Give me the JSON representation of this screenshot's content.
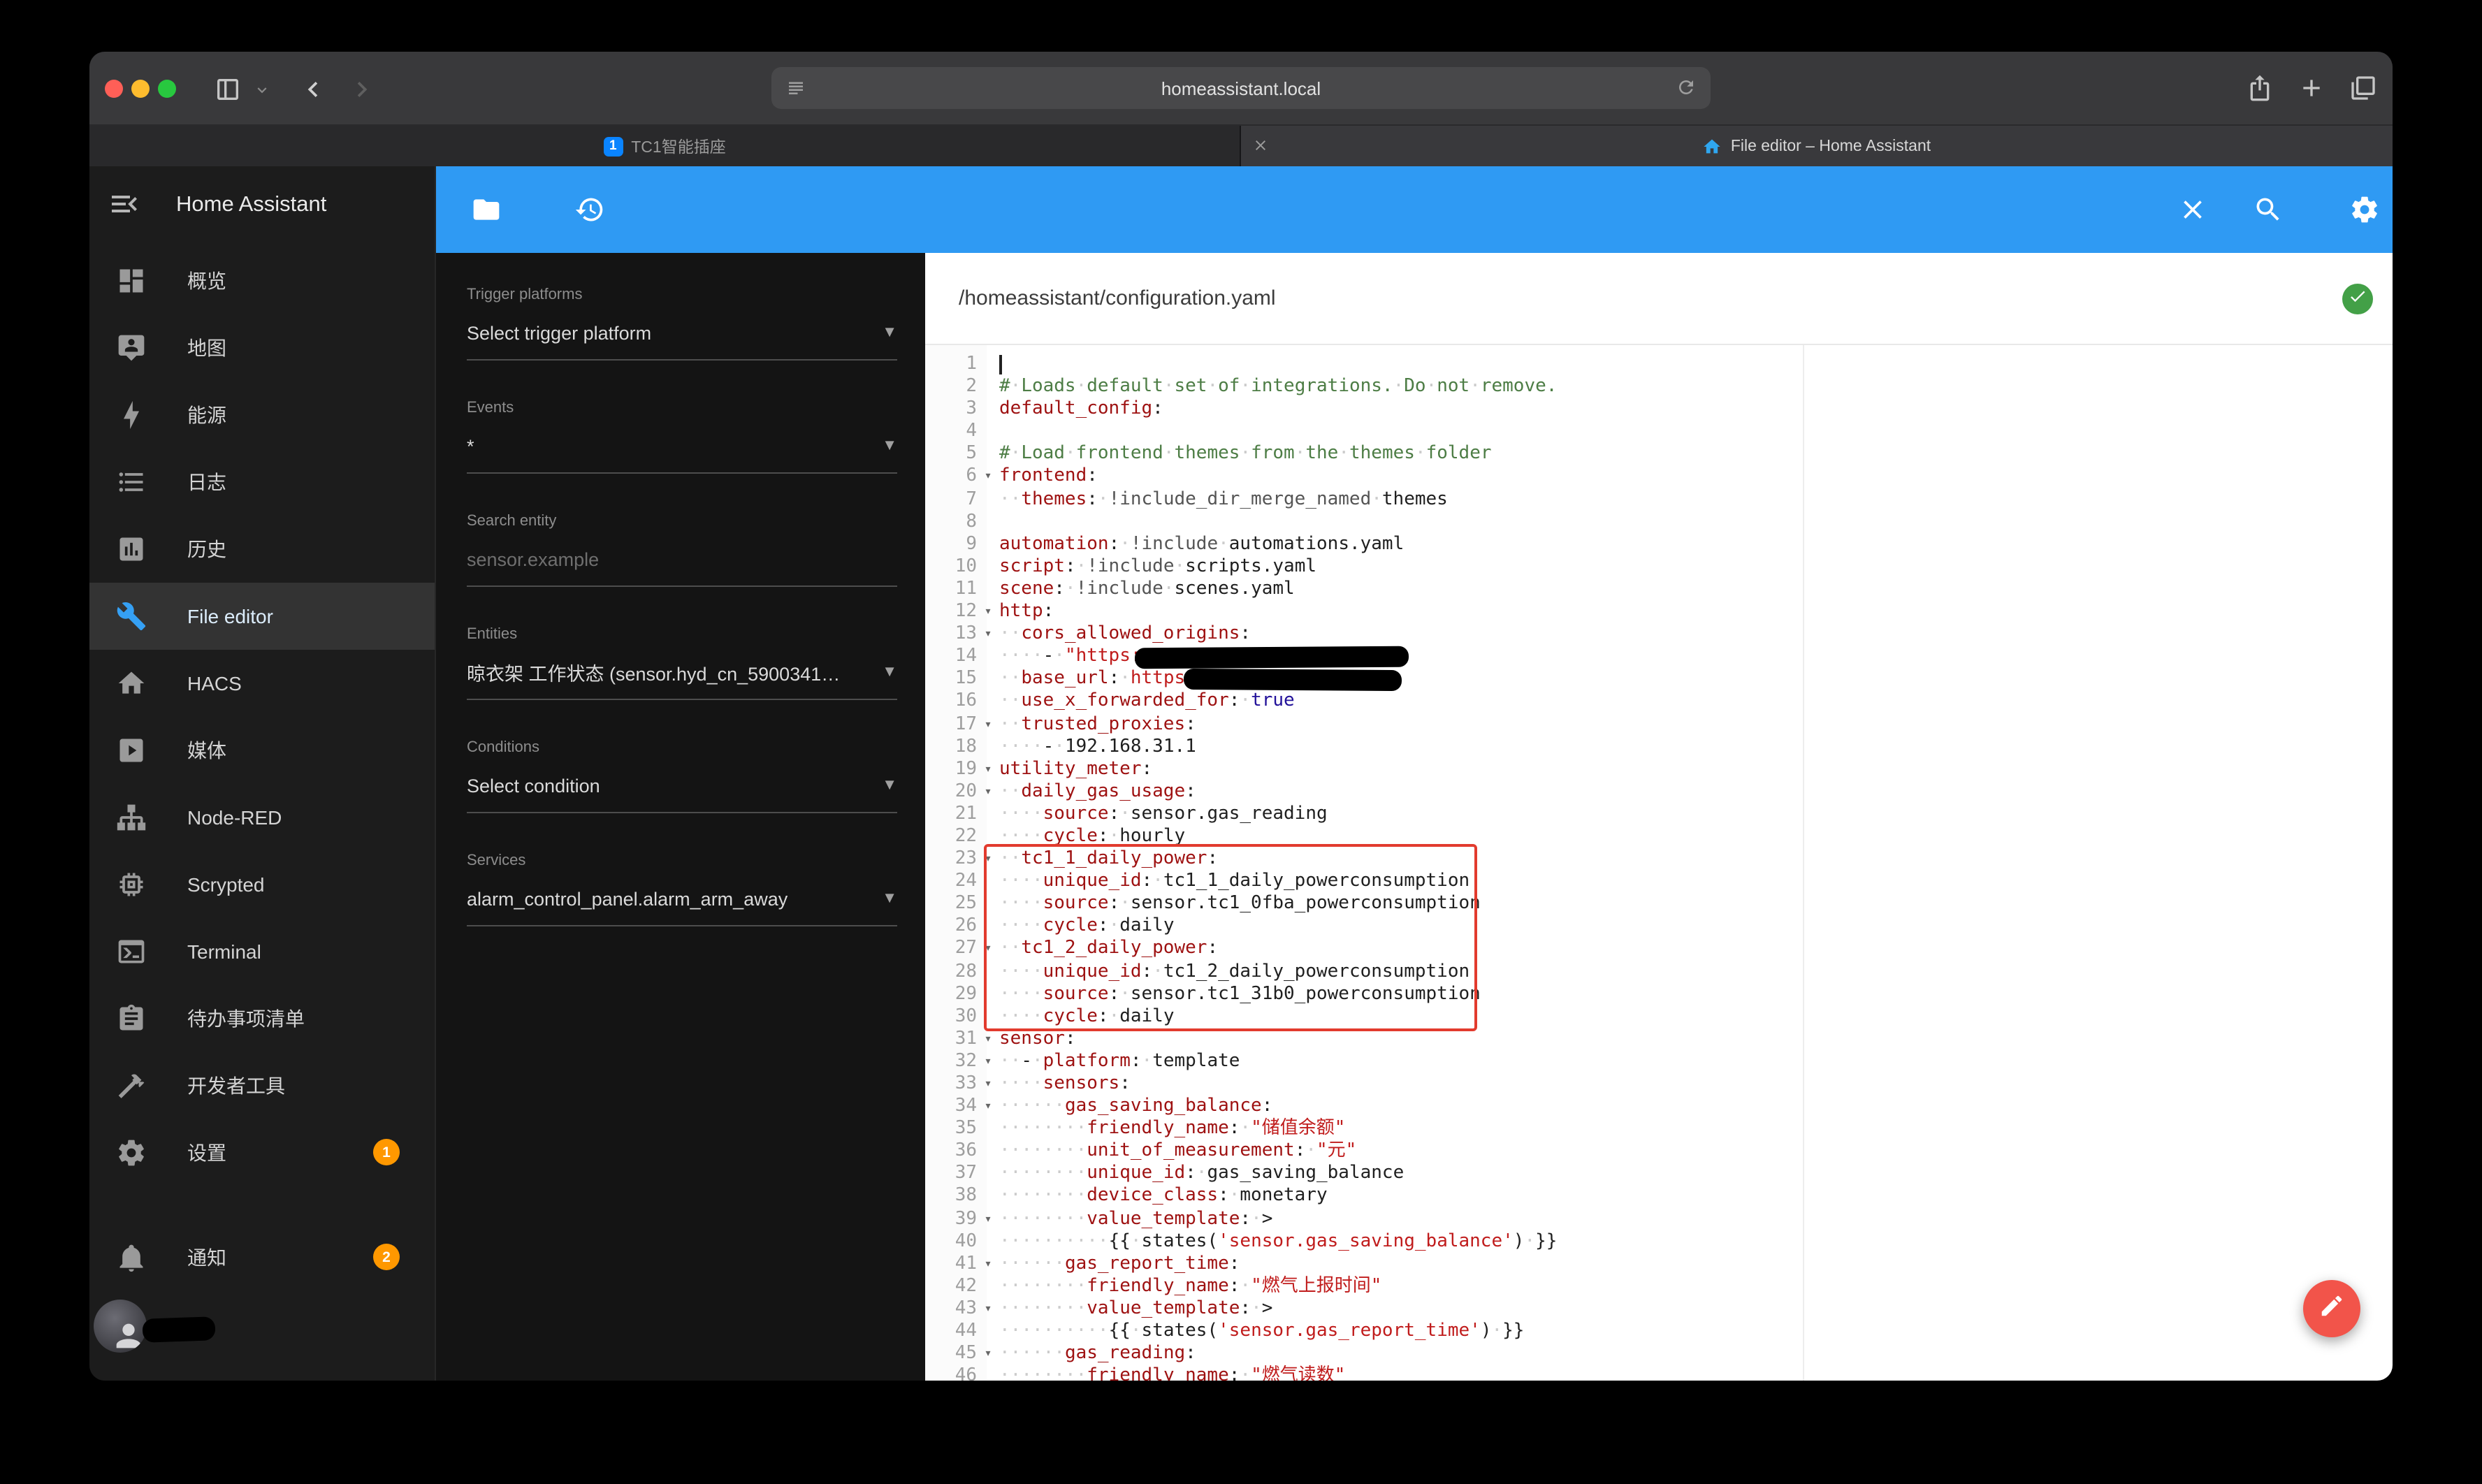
{
  "colors": {
    "toolbar-blue": "#2f9af3",
    "accent-orange": "#ff9800",
    "fab-red": "#f2544a",
    "annotation-red": "#e23b2e",
    "check-green": "#43a047",
    "selected-blue": "#35a0f4"
  },
  "browser": {
    "url": "homeassistant.local",
    "tabs": [
      {
        "label": "TC1智能插座",
        "badge": "1"
      },
      {
        "label": "File editor – Home Assistant"
      }
    ]
  },
  "ha": {
    "title": "Home Assistant",
    "menu": [
      {
        "id": "overview",
        "label": "概览",
        "icon": "view-dashboard"
      },
      {
        "id": "map",
        "label": "地图",
        "icon": "tooltip-account"
      },
      {
        "id": "energy",
        "label": "能源",
        "icon": "lightning-bolt"
      },
      {
        "id": "logbook",
        "label": "日志",
        "icon": "format-list"
      },
      {
        "id": "history",
        "label": "历史",
        "icon": "chart-box"
      },
      {
        "id": "file-editor",
        "label": "File editor",
        "icon": "wrench",
        "selected": true
      },
      {
        "id": "hacs",
        "label": "HACS",
        "icon": "home"
      },
      {
        "id": "media",
        "label": "媒体",
        "icon": "play-box"
      },
      {
        "id": "node-red",
        "label": "Node-RED",
        "icon": "sitemap"
      },
      {
        "id": "scrypted",
        "label": "Scrypted",
        "icon": "memory"
      },
      {
        "id": "terminal",
        "label": "Terminal",
        "icon": "console"
      },
      {
        "id": "todo",
        "label": "待办事项清单",
        "icon": "clipboard"
      },
      {
        "id": "dev-tools",
        "label": "开发者工具",
        "icon": "hammer"
      },
      {
        "id": "settings",
        "label": "设置",
        "icon": "cog",
        "badge": "1"
      }
    ],
    "notifications": {
      "label": "通知",
      "badge": "2"
    }
  },
  "automation_panel": {
    "groups": [
      {
        "id": "trigger-platforms",
        "label": "Trigger platforms",
        "type": "select",
        "value": "Select trigger platform"
      },
      {
        "id": "events",
        "label": "Events",
        "type": "select",
        "value": "*"
      },
      {
        "id": "search-entity",
        "label": "Search entity",
        "type": "input",
        "placeholder": "sensor.example"
      },
      {
        "id": "entities",
        "label": "Entities",
        "type": "select",
        "value": "晾衣架 工作状态 (sensor.hyd_cn_5900341…"
      },
      {
        "id": "conditions",
        "label": "Conditions",
        "type": "select",
        "value": "Select condition"
      },
      {
        "id": "services",
        "label": "Services",
        "type": "select",
        "value": "alarm_control_panel.alarm_arm_away"
      }
    ]
  },
  "editor_toolbar": {
    "left_icons": [
      "folder",
      "history"
    ],
    "right_icons": [
      "close",
      "search",
      "cog"
    ]
  },
  "editor": {
    "path": "/homeassistant/configuration.yaml",
    "status": "valid",
    "fold_lines": [
      6,
      12,
      13,
      17,
      19,
      20,
      23,
      27,
      31,
      32,
      33,
      34,
      39,
      41,
      43,
      45
    ],
    "annotations": {
      "red_box_lines": [
        23,
        30
      ],
      "redacted_lines": [
        14,
        15
      ]
    },
    "lines": [
      "",
      "# Loads default set of integrations. Do not remove.",
      "default_config:",
      "",
      "# Load frontend themes from the themes folder",
      "frontend:",
      "  themes: !include_dir_merge_named themes",
      "",
      "automation: !include automations.yaml",
      "script: !include scripts.yaml",
      "scene: !include scenes.yaml",
      "http:",
      "  cors_allowed_origins:",
      "    - \"https:",
      "  base_url: https",
      "  use_x_forwarded_for: true",
      "  trusted_proxies:",
      "    - 192.168.31.1",
      "utility_meter:",
      "  daily_gas_usage:",
      "    source: sensor.gas_reading",
      "    cycle: hourly",
      "  tc1_1_daily_power:",
      "    unique_id: tc1_1_daily_powerconsumption",
      "    source: sensor.tc1_0fba_powerconsumption",
      "    cycle: daily",
      "  tc1_2_daily_power:",
      "    unique_id: tc1_2_daily_powerconsumption",
      "    source: sensor.tc1_31b0_powerconsumption",
      "    cycle: daily",
      "sensor:",
      "  - platform: template",
      "    sensors:",
      "      gas_saving_balance:",
      "        friendly_name: \"储值余额\"",
      "        unit_of_measurement: \"元\"",
      "        unique_id: gas_saving_balance",
      "        device_class: monetary",
      "        value_template: >",
      "          {{ states('sensor.gas_saving_balance') }}",
      "      gas_report_time:",
      "        friendly_name: \"燃气上报时间\"",
      "        value_template: >",
      "          {{ states('sensor.gas_report_time') }}",
      "      gas_reading:",
      "        friendly_name: \"燃气读数\""
    ]
  }
}
